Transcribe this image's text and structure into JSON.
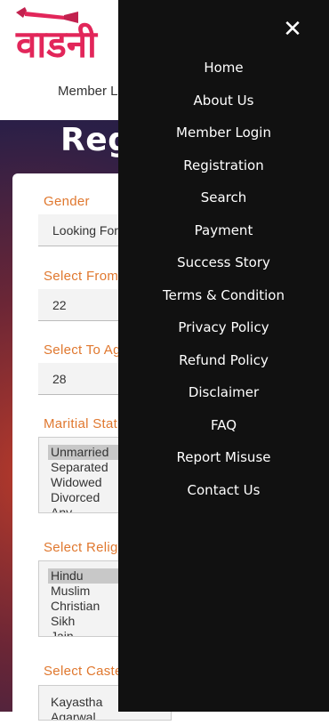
{
  "header": {
    "logo_text": "वाडनी",
    "member_link": "Member L"
  },
  "hero": {
    "title": "Regu"
  },
  "form": {
    "gender": {
      "label": "Gender",
      "value": "Looking For"
    },
    "from_age": {
      "label": "Select From",
      "value": "22"
    },
    "to_age": {
      "label": "Select To Ag",
      "value": "28"
    },
    "marital": {
      "label": "Maritial Stat",
      "options": [
        "Unmarried",
        "Separated",
        "Widowed",
        "Divorced",
        "Any"
      ]
    },
    "religion": {
      "label": "Select Relig",
      "options": [
        "Hindu",
        "Muslim",
        "Christian",
        "Sikh",
        "Jain"
      ]
    },
    "caste": {
      "label": "Select Caste",
      "options": [
        "Kayastha",
        "Agarwal"
      ]
    }
  },
  "drawer": {
    "close_label": "✕",
    "items": [
      "Home",
      "About Us",
      "Member Login",
      "Registration",
      "Search",
      "Payment",
      "Success Story",
      "Terms & Condition",
      "Privacy Policy",
      "Refund Policy",
      "Disclaimer",
      "FAQ",
      "Report Misuse",
      "Contact Us"
    ]
  },
  "colors": {
    "accent": "#e0782f",
    "logo": "#e2265a",
    "drawer": "#111111"
  }
}
